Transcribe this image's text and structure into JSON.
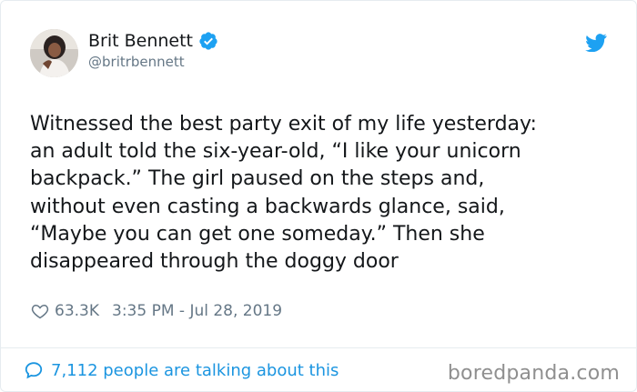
{
  "tweet": {
    "author_name": "Brit Bennett",
    "author_handle": "@britrbennett",
    "text": "Witnessed the best party exit of my life yesterday:\nan adult told the six-year-old, “I like your unicorn\nbackpack.” The girl paused on the steps and,\nwithout even casting a backwards glance, said,\n“Maybe you can get one someday.” Then she\ndisappeared through the doggy door",
    "likes": "63.3K",
    "timestamp": "3:35 PM - Jul 28, 2019",
    "talking": "7,112 people are talking about this"
  },
  "watermark": "boredpanda.com",
  "icons": {
    "verified": "verified-badge-icon",
    "brand": "twitter-bird-icon",
    "like": "heart-icon",
    "reply": "speech-bubble-icon"
  },
  "colors": {
    "brand_blue": "#1da1f2",
    "link_blue": "#1b95e0",
    "secondary_text": "#657786",
    "primary_text": "#14171a",
    "divider": "#e6ecf0"
  }
}
